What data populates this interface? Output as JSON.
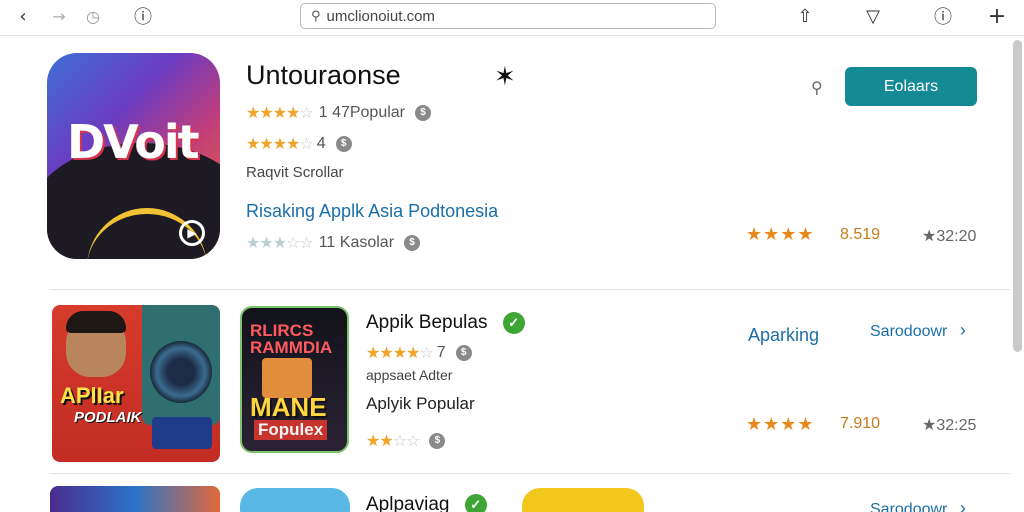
{
  "toolbar": {
    "back_glyph": "‹",
    "forward_glyph": "→",
    "history_glyph": "◷",
    "alert_glyph": "ⓘ",
    "url": "umclionoiut.com",
    "share_glyph": "⇧",
    "pocket_glyph": "▽",
    "info_glyph": "ⓘ",
    "new_tab_glyph": "+"
  },
  "featured": {
    "icon_text": "DVoit",
    "title": "Untouraonse",
    "close_glyph": "✶",
    "rating1": {
      "stars": "★★★★",
      "half": "☆",
      "text": "1 47Popular"
    },
    "rating2": {
      "stars": "★★★★",
      "half": "☆",
      "text": "4"
    },
    "subtitle": "Raqvit Scrollar",
    "link": "Risaking Applk Asia Podtonesia",
    "rating3": {
      "stars": "★★★",
      "off": "☆☆",
      "text": "11 Kasolar"
    },
    "search_glyph": "⚲",
    "button_label": "Eolaars",
    "right_stars": "★★★★",
    "score": "8.519",
    "count": "★32:20"
  },
  "row2": {
    "thumb1_line1": "APlIar",
    "thumb1_line2": "PODLAIK",
    "thumb2_line1": "RLIRCS RAMMDIA",
    "thumb2_line2": "MANE",
    "thumb2_line3": "Fopulex",
    "title": "Appik Bepulas",
    "rating1": {
      "stars": "★★★★",
      "half": "☆",
      "text": "7"
    },
    "subtitle": "appsaet Adter",
    "line2": "Aplyik Popular",
    "rating2": {
      "stars": "★★",
      "off": "☆☆"
    },
    "label": "Aparking",
    "link": "Sarodoowr",
    "chevron": "›",
    "right_stars": "★★★★",
    "score": "7.910",
    "count": "★32:25"
  },
  "row3": {
    "title": "Aplpaviag",
    "link": "Sarodoowr",
    "chevron": "›"
  }
}
